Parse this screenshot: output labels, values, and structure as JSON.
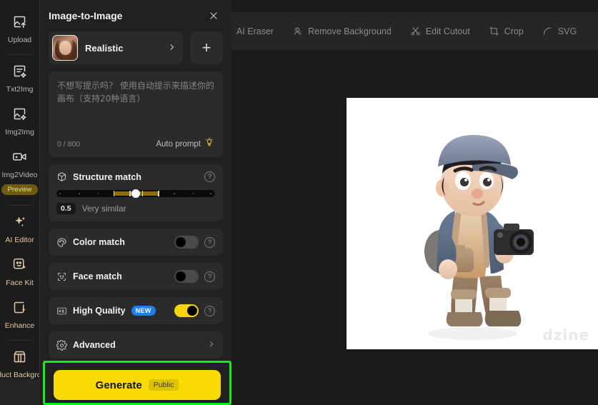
{
  "app": {
    "canvas_bg": "#1b1b1b",
    "accent_yellow": "#fada05",
    "highlight_green": "#16ed16"
  },
  "toolbar": {
    "items": [
      {
        "label": "AI Eraser",
        "icon": "eraser-icon"
      },
      {
        "label": "Remove Background",
        "icon": "remove-background-icon"
      },
      {
        "label": "Edit Cutout",
        "icon": "scissors-icon"
      },
      {
        "label": "Crop",
        "icon": "crop-icon"
      },
      {
        "label": "SVG",
        "icon": "svg-curve-icon"
      }
    ]
  },
  "rail": {
    "items": [
      {
        "label": "Upload",
        "icon": "upload-image-icon",
        "accent": false
      },
      {
        "label": "Txt2Img",
        "icon": "text-to-image-icon",
        "accent": false
      },
      {
        "label": "Img2Img",
        "icon": "image-to-image-icon",
        "accent": false
      },
      {
        "label": "Img2Video",
        "icon": "image-to-video-icon",
        "accent": false,
        "badge": "Preview"
      },
      {
        "label": "AI Editor",
        "icon": "sparkles-icon",
        "accent": true
      },
      {
        "label": "Face Kit",
        "icon": "face-kit-icon",
        "accent": true
      },
      {
        "label": "Enhance",
        "icon": "enhance-icon",
        "accent": true
      },
      {
        "label": "Product Background",
        "icon": "product-background-icon",
        "accent": true
      }
    ]
  },
  "panel": {
    "title": "Image-to-Image",
    "close_icon": "close-icon",
    "style": {
      "name": "Realistic",
      "chevron_icon": "chevron-right-icon",
      "thumbnail_alt": "realistic-portrait-thumbnail",
      "add_label": "+"
    },
    "prompt": {
      "placeholder": "不想写提示吗？ 使用自动提示来描述你的画布（支持20种语言）",
      "value": "",
      "counter": "0 / 800",
      "auto_prompt_label": "Auto prompt",
      "auto_prompt_icon": "lightbulb-icon"
    },
    "structure_match": {
      "title": "Structure match",
      "icon": "cube-icon",
      "help_icon": "help-icon",
      "value": "0.5",
      "description": "Very similar",
      "min": 0,
      "max": 1,
      "thumb_percent": 50,
      "fill_start_percent": 36,
      "fill_width_percent": 28
    },
    "color_match": {
      "title": "Color match",
      "icon": "palette-icon",
      "help_icon": "help-icon",
      "enabled": false
    },
    "face_match": {
      "title": "Face match",
      "icon": "face-smile-icon",
      "help_icon": "help-icon",
      "enabled": false
    },
    "high_quality": {
      "title": "High Quality",
      "icon": "hq-icon",
      "badge": "NEW",
      "help_icon": "help-icon",
      "enabled": true
    },
    "advanced": {
      "title": "Advanced",
      "icon": "gear-icon",
      "chevron_icon": "chevron-right-icon"
    },
    "generate": {
      "label": "Generate",
      "visibility": "Public"
    }
  },
  "canvas": {
    "image_alt": "3d-cartoon-boy-with-camera",
    "watermark": "dzine"
  }
}
